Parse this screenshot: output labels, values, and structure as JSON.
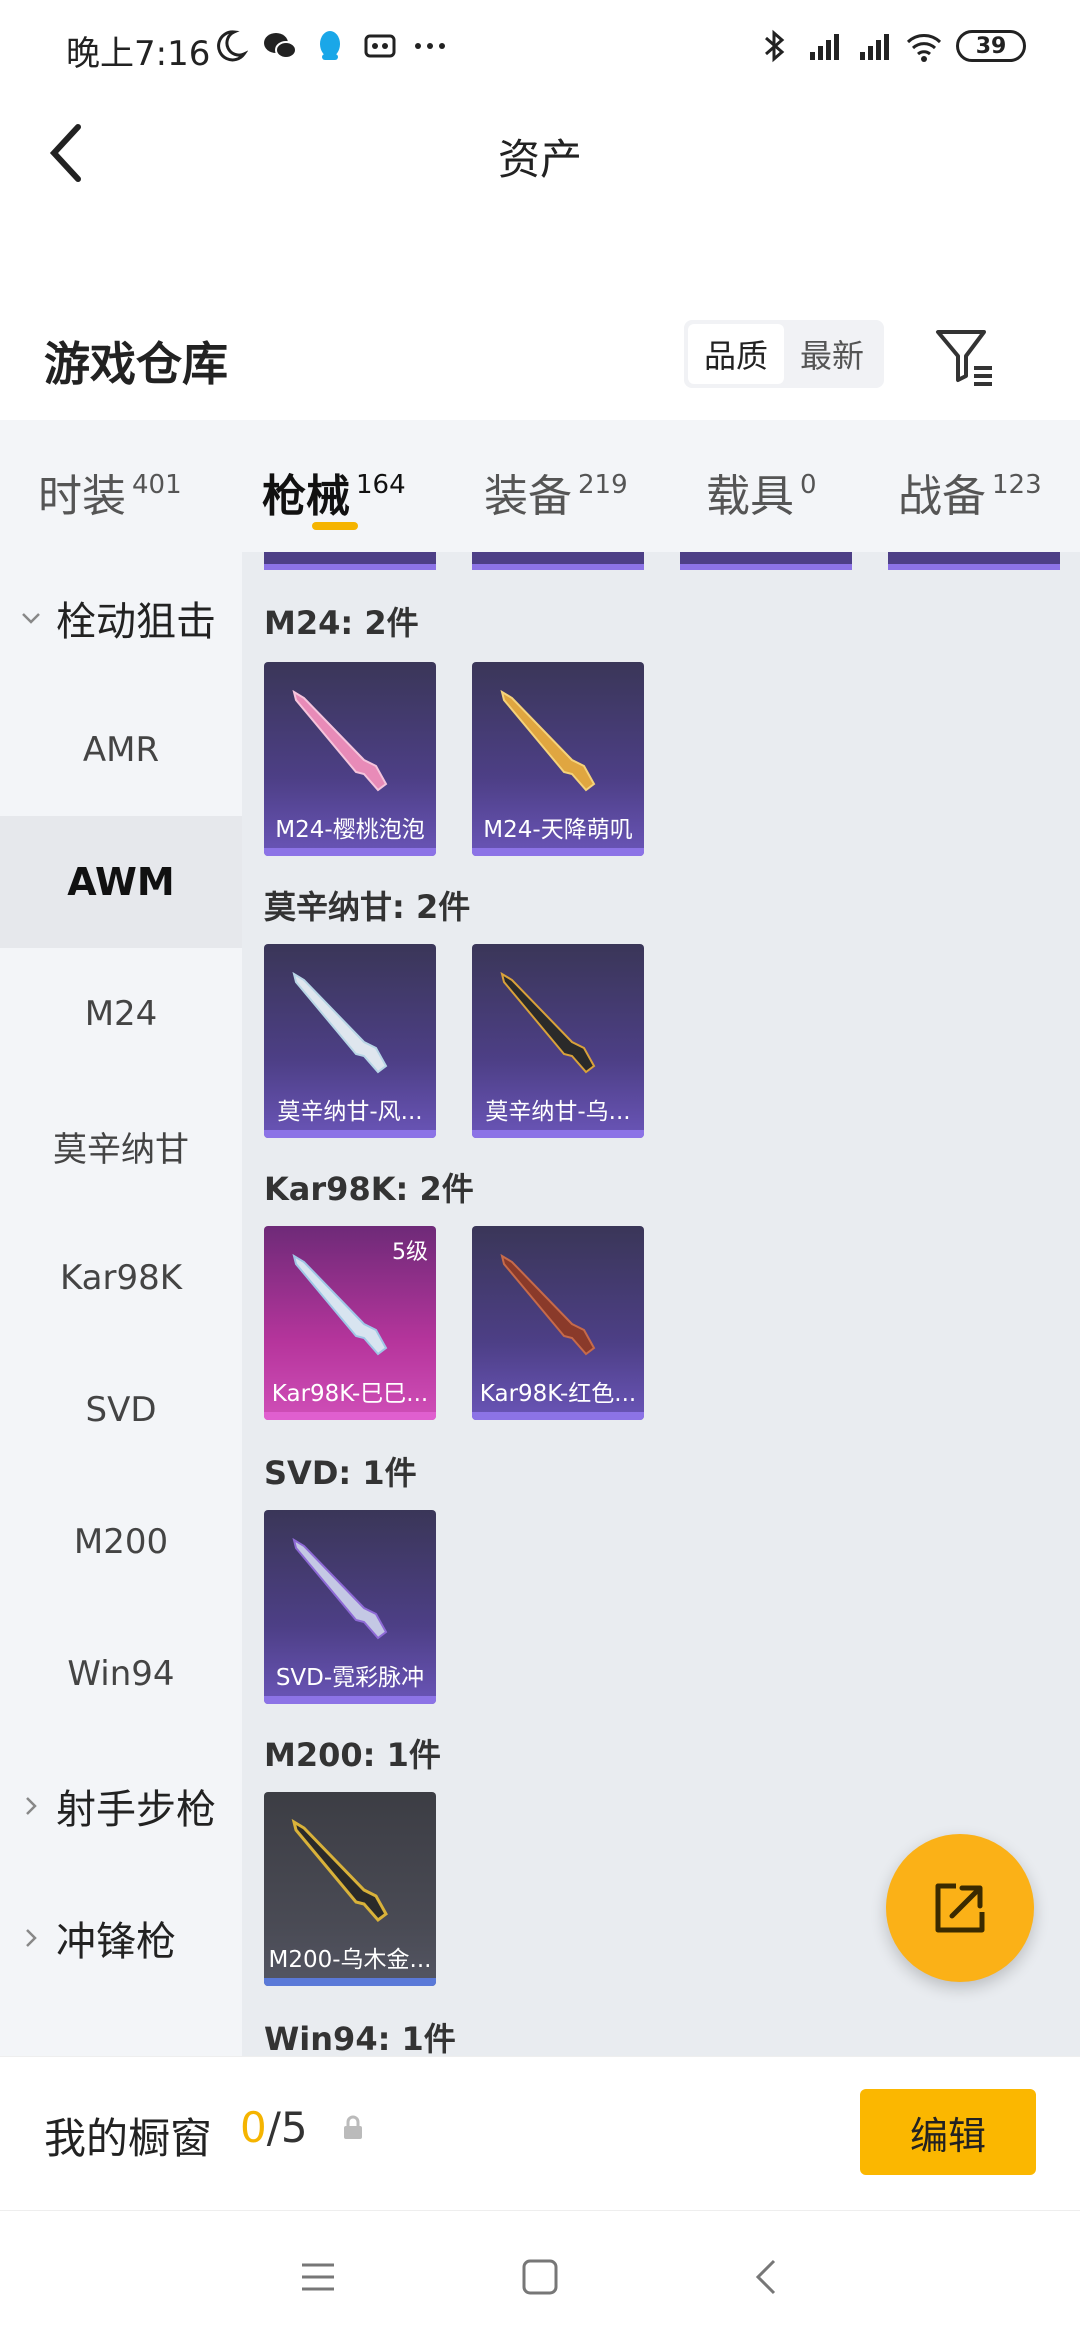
{
  "status_bar": {
    "time": "晚上7:16",
    "battery": "39"
  },
  "header": {
    "title": "资产"
  },
  "warehouse": {
    "title": "游戏仓库",
    "sort_options": [
      "品质",
      "最新"
    ],
    "active_sort": "品质"
  },
  "categories": [
    {
      "label": "时装",
      "count": "401"
    },
    {
      "label": "枪械",
      "count": "164"
    },
    {
      "label": "装备",
      "count": "219"
    },
    {
      "label": "载具",
      "count": "0"
    },
    {
      "label": "战备",
      "count": "123"
    }
  ],
  "sidebar": {
    "groups": [
      {
        "label": "栓动狙击"
      },
      {
        "label": "射手步枪"
      },
      {
        "label": "冲锋枪"
      }
    ],
    "items": [
      "AMR",
      "AWM",
      "M24",
      "莫辛纳甘",
      "Kar98K",
      "SVD",
      "M200",
      "Win94"
    ]
  },
  "content": {
    "groups": [
      {
        "title": "M24: 2件",
        "items": [
          {
            "name": "M24-樱桃泡泡"
          },
          {
            "name": "M24-天降萌叽"
          }
        ]
      },
      {
        "title": "莫辛纳甘: 2件",
        "items": [
          {
            "name": "莫辛纳甘-风..."
          },
          {
            "name": "莫辛纳甘-乌..."
          }
        ]
      },
      {
        "title": "Kar98K: 2件",
        "items": [
          {
            "name": "Kar98K-巳巳...",
            "level": "5级"
          },
          {
            "name": "Kar98K-红色..."
          }
        ]
      },
      {
        "title": "SVD: 1件",
        "items": [
          {
            "name": "SVD-霓彩脉冲"
          }
        ]
      },
      {
        "title": "M200: 1件",
        "items": [
          {
            "name": "M200-乌木金..."
          }
        ]
      },
      {
        "title": "Win94: 1件",
        "items": []
      }
    ]
  },
  "showcase": {
    "label": "我的橱窗",
    "current": "0",
    "total": "/5",
    "edit_label": "编辑"
  },
  "colors": {
    "accent": "#f5b400",
    "card_purple": "#4d3f86",
    "card_pink": "#b6359c"
  }
}
